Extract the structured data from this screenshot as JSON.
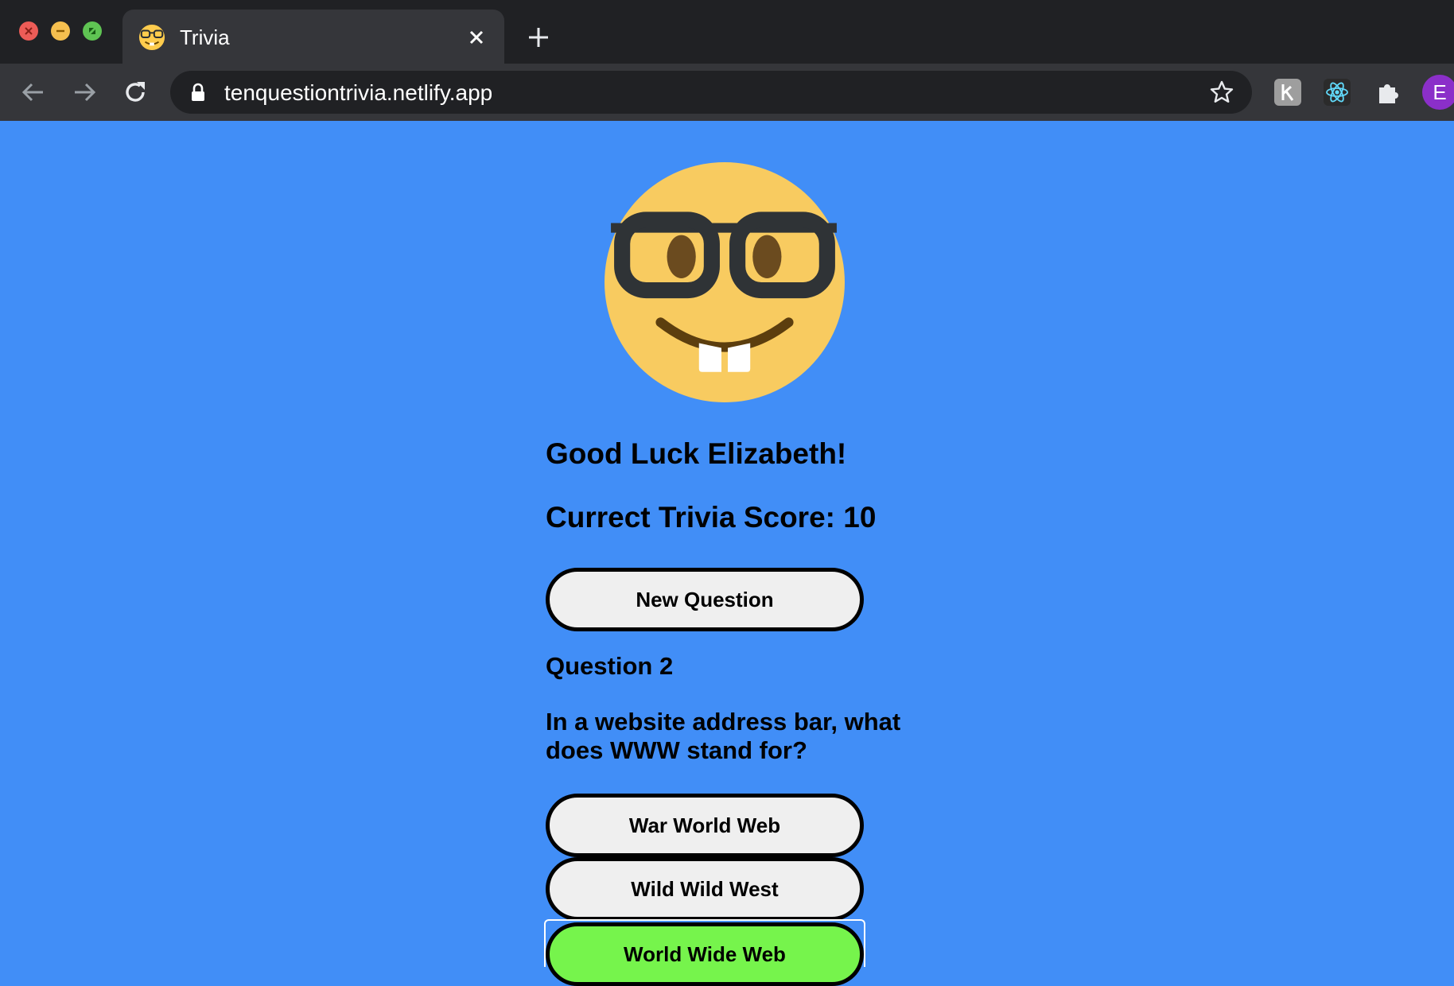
{
  "browser": {
    "tab": {
      "title": "Trivia",
      "favicon": "nerd-face-icon"
    },
    "address_bar": {
      "url": "tenquestiontrivia.netlify.app"
    },
    "profile_initial": "E",
    "colors": {
      "tabstrip": "#202124",
      "toolbar": "#35363a",
      "profile": "#8b2fc9"
    }
  },
  "page": {
    "background": "#418ef7",
    "mascot": "nerd-face-icon",
    "greeting": "Good Luck Elizabeth!",
    "score_text": "Currect Trivia Score: 10",
    "new_question_label": "New Question",
    "question_number": "Question 2",
    "question_text": "In a website address bar, what does WWW stand for?",
    "answers": [
      {
        "label": "War World Web",
        "state": "default"
      },
      {
        "label": "Wild Wild West",
        "state": "default"
      },
      {
        "label": "World Wide Web",
        "state": "correct"
      }
    ],
    "colors": {
      "button": "#efefef",
      "correct_answer": "#76f44c"
    }
  }
}
